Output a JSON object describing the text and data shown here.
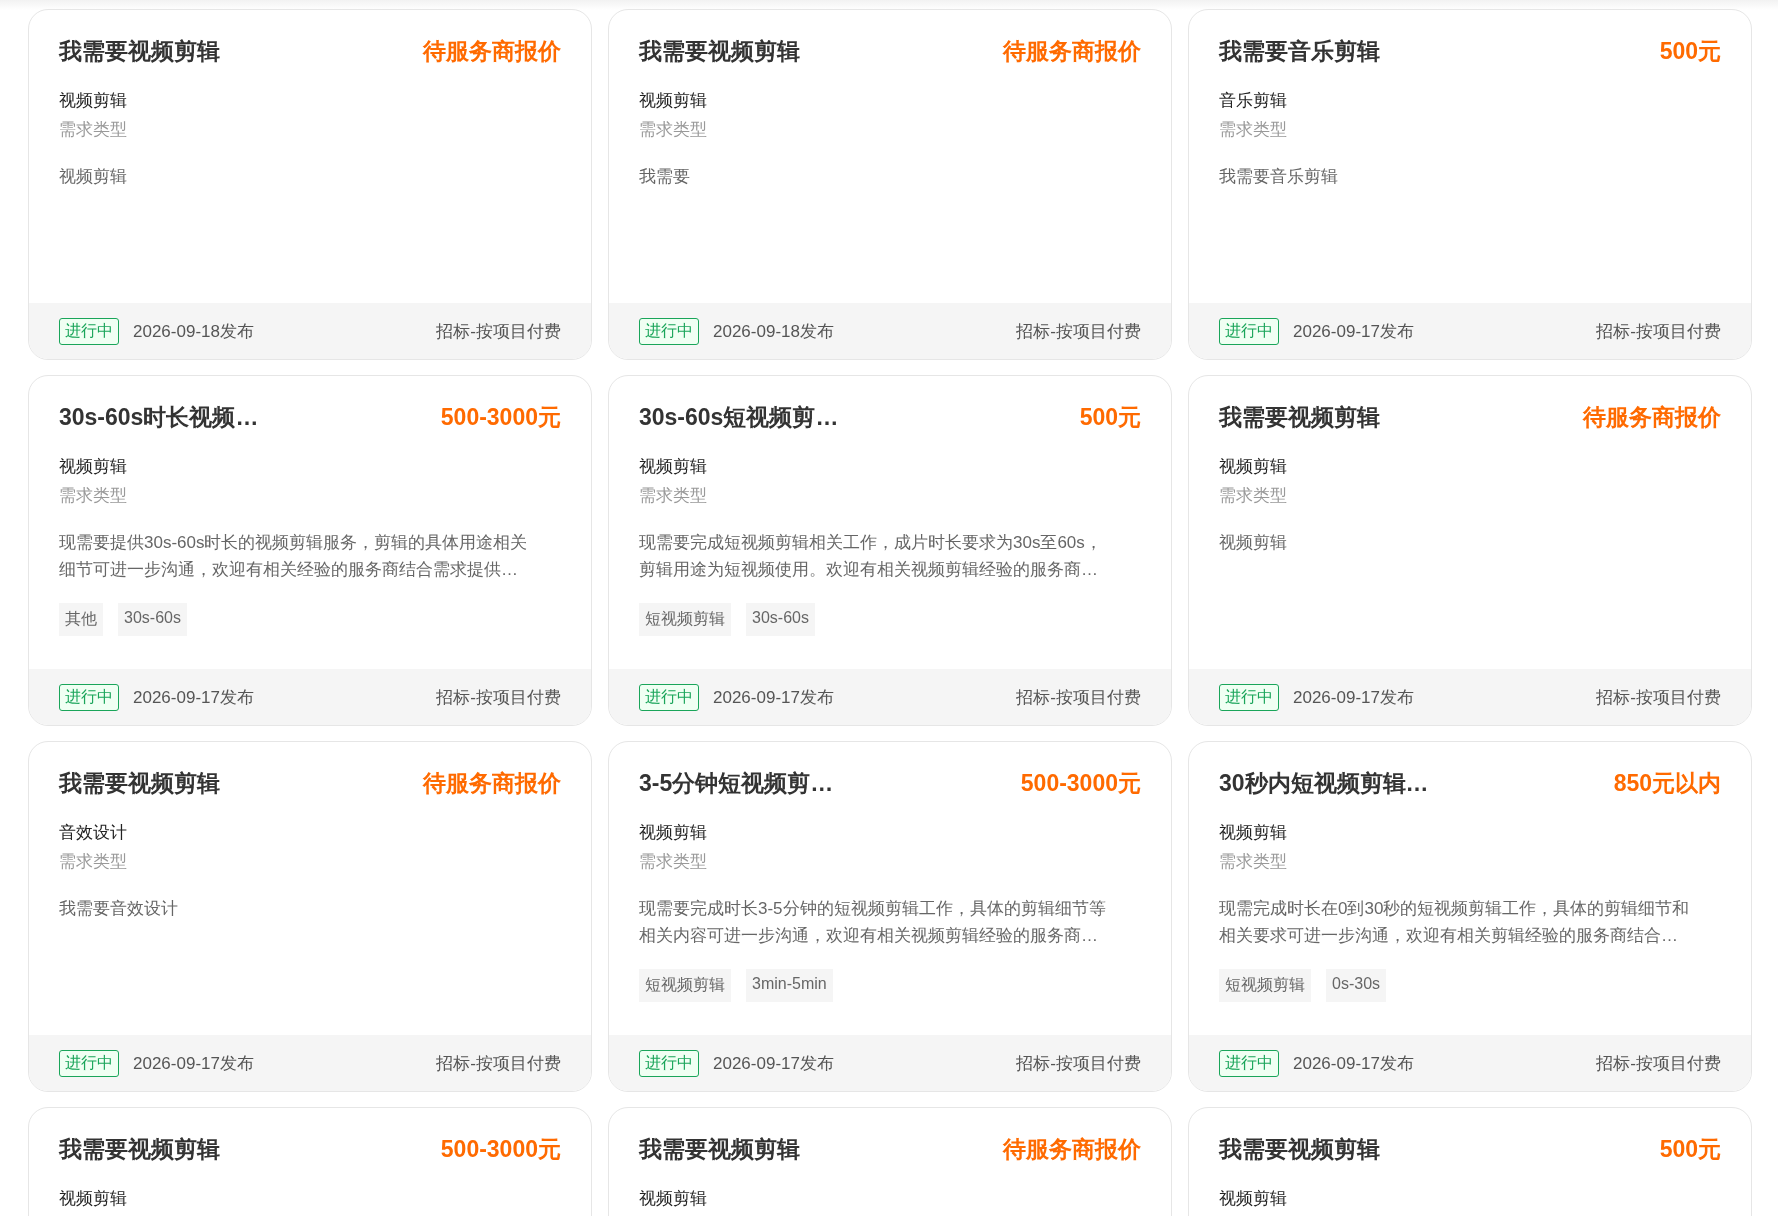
{
  "cards": [
    {
      "title": "我需要视频剪辑",
      "price": "待服务商报价",
      "category": "视频剪辑",
      "type_label": "需求类型",
      "description_lines": [
        "视频剪辑"
      ],
      "status": "进行中",
      "date": "2026-09-18发布",
      "billing": "招标-按项目付费"
    },
    {
      "title": "我需要视频剪辑",
      "price": "待服务商报价",
      "category": "视频剪辑",
      "type_label": "需求类型",
      "description_lines": [
        "我需要"
      ],
      "status": "进行中",
      "date": "2026-09-18发布",
      "billing": "招标-按项目付费"
    },
    {
      "title": "我需要音乐剪辑",
      "price": "500元",
      "category": "音乐剪辑",
      "type_label": "需求类型",
      "description_lines": [
        "我需要音乐剪辑"
      ],
      "status": "进行中",
      "date": "2026-09-17发布",
      "billing": "招标-按项目付费"
    },
    {
      "title": "30s-60s时长视频…",
      "price": "500-3000元",
      "category": "视频剪辑",
      "type_label": "需求类型",
      "description_lines": [
        "现需要提供30s-60s时长的视频剪辑服务，剪辑的具体用途相关",
        "细节可进一步沟通，欢迎有相关经验的服务商结合需求提供…"
      ],
      "tags": [
        "其他",
        "30s-60s"
      ],
      "status": "进行中",
      "date": "2026-09-17发布",
      "billing": "招标-按项目付费"
    },
    {
      "title": "30s-60s短视频剪…",
      "price": "500元",
      "category": "视频剪辑",
      "type_label": "需求类型",
      "description_lines": [
        "现需要完成短视频剪辑相关工作，成片时长要求为30s至60s，",
        "剪辑用途为短视频使用。欢迎有相关视频剪辑经验的服务商…"
      ],
      "tags": [
        "短视频剪辑",
        "30s-60s"
      ],
      "status": "进行中",
      "date": "2026-09-17发布",
      "billing": "招标-按项目付费"
    },
    {
      "title": "我需要视频剪辑",
      "price": "待服务商报价",
      "category": "视频剪辑",
      "type_label": "需求类型",
      "description_lines": [
        "视频剪辑"
      ],
      "status": "进行中",
      "date": "2026-09-17发布",
      "billing": "招标-按项目付费"
    },
    {
      "title": "我需要视频剪辑",
      "price": "待服务商报价",
      "category": "音效设计",
      "type_label": "需求类型",
      "description_lines": [
        "我需要音效设计"
      ],
      "status": "进行中",
      "date": "2026-09-17发布",
      "billing": "招标-按项目付费"
    },
    {
      "title": "3-5分钟短视频剪…",
      "price": "500-3000元",
      "category": "视频剪辑",
      "type_label": "需求类型",
      "description_lines": [
        "现需要完成时长3-5分钟的短视频剪辑工作，具体的剪辑细节等",
        "相关内容可进一步沟通，欢迎有相关视频剪辑经验的服务商…"
      ],
      "tags": [
        "短视频剪辑",
        "3min-5min"
      ],
      "status": "进行中",
      "date": "2026-09-17发布",
      "billing": "招标-按项目付费"
    },
    {
      "title": "30秒内短视频剪辑…",
      "price": "850元以内",
      "category": "视频剪辑",
      "type_label": "需求类型",
      "description_lines": [
        "现需完成时长在0到30秒的短视频剪辑工作，具体的剪辑细节和",
        "相关要求可进一步沟通，欢迎有相关剪辑经验的服务商结合…"
      ],
      "tags": [
        "短视频剪辑",
        "0s-30s"
      ],
      "status": "进行中",
      "date": "2026-09-17发布",
      "billing": "招标-按项目付费"
    },
    {
      "title": "我需要视频剪辑",
      "price": "500-3000元",
      "category": "视频剪辑"
    },
    {
      "title": "我需要视频剪辑",
      "price": "待服务商报价",
      "category": "视频剪辑"
    },
    {
      "title": "我需要视频剪辑",
      "price": "500元",
      "category": "视频剪辑"
    }
  ]
}
